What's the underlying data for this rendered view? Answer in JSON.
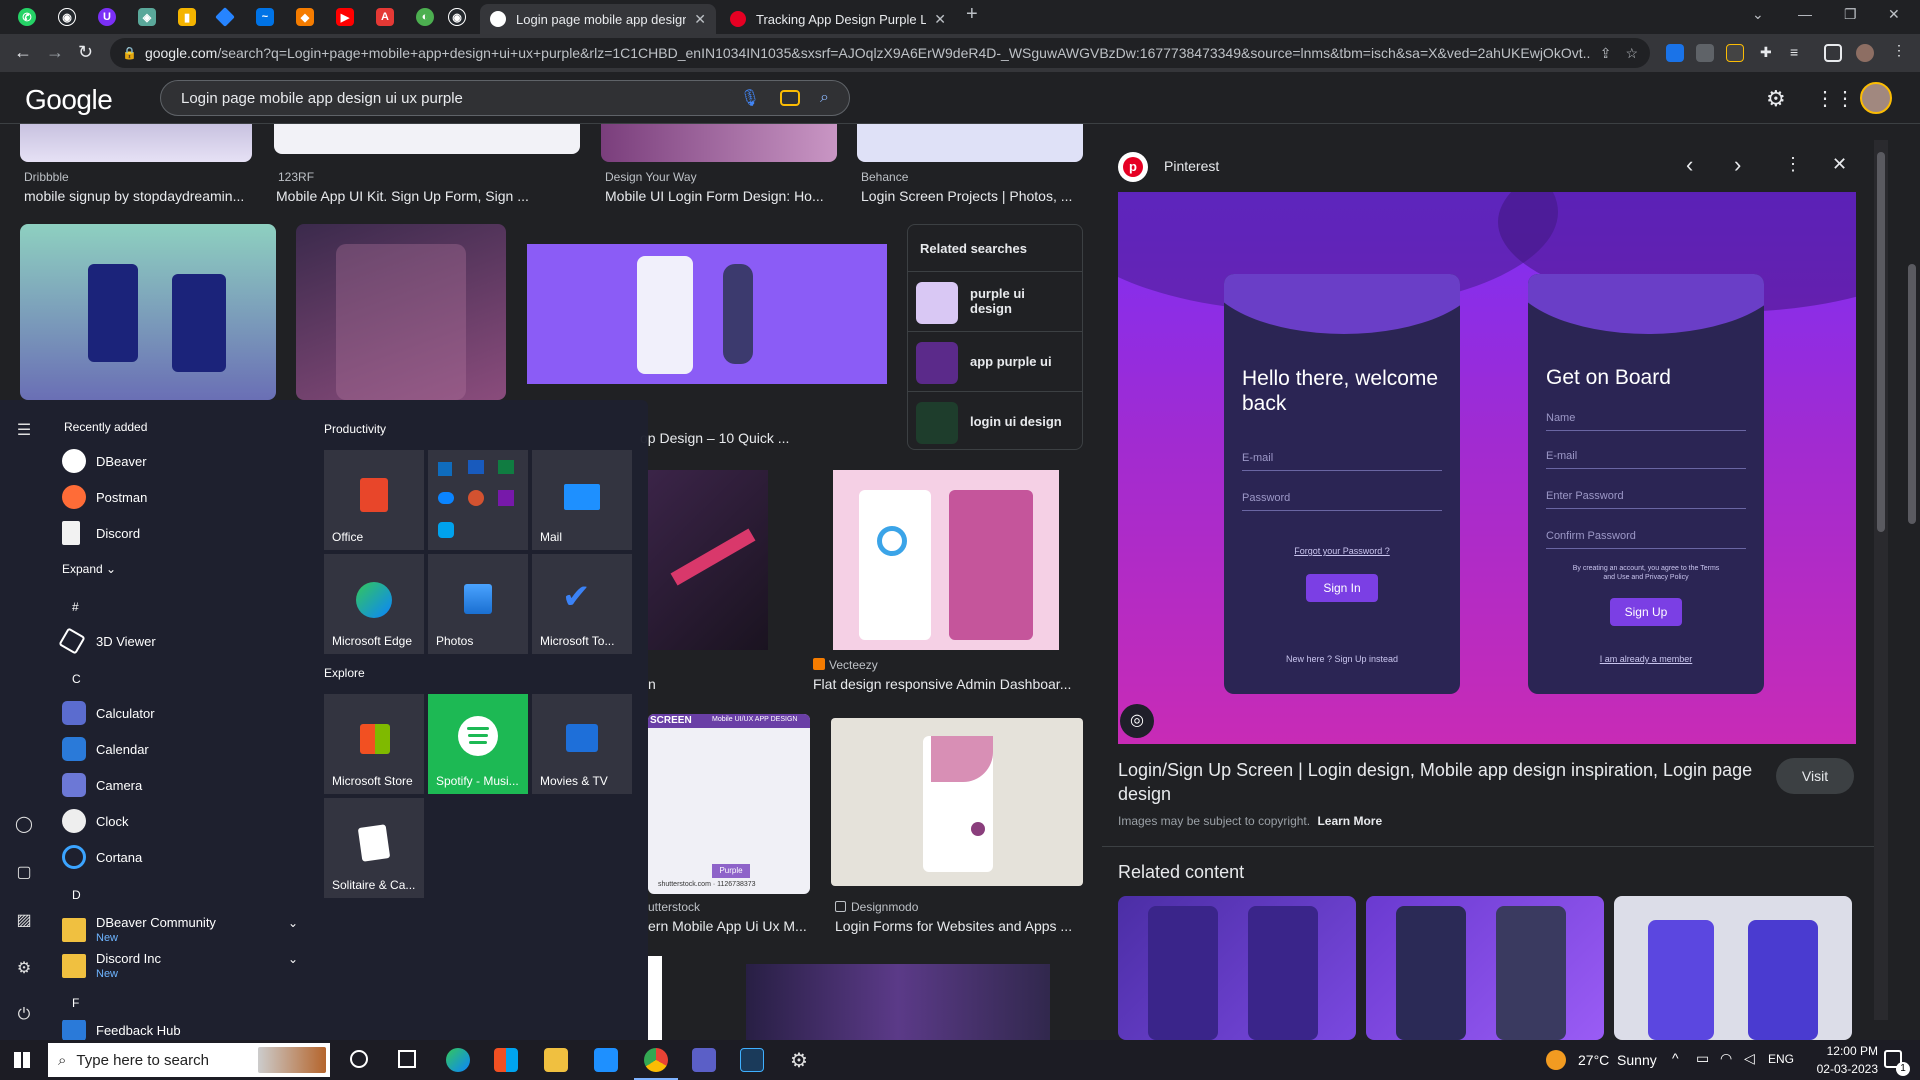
{
  "browser": {
    "tabs": [
      {
        "title": "Login page mobile app design ui",
        "active": true
      },
      {
        "title": "Tracking App Design Purple Logi",
        "active": false
      }
    ],
    "new_tab": "+",
    "url_host": "google.com",
    "url_rest": "/search?q=Login+page+mobile+app+design+ui+ux+purple&rlz=1C1CHBD_enIN1034IN1035&sxsrf=AJOqlzX9A6ErW9deR4D-_WSguwAWGVBzDw:1677738473349&source=lnms&tbm=isch&sa=X&ved=2ahUKEwjOkOvt..."
  },
  "google": {
    "logo": "Google",
    "query": "Login page mobile app design ui ux purple"
  },
  "results": {
    "row1": [
      {
        "source": "Dribbble",
        "title": "mobile signup by stopdaydreamin..."
      },
      {
        "source": "123RF",
        "title": "Mobile App UI Kit. Sign Up Form, Sign ..."
      },
      {
        "source": "Design Your Way",
        "title": "Mobile UI Login Form Design: Ho..."
      },
      {
        "source": "Behance",
        "title": "Login Screen Projects | Photos, ..."
      }
    ],
    "partial_title_1": "op Design – 10 Quick ...",
    "vecteezy": {
      "source": "Vecteezy",
      "title": "Flat design responsive Admin Dashboar..."
    },
    "shutterstock": {
      "source": "utterstock",
      "title": "ern Mobile App Ui Ux M...",
      "badge": "Purple",
      "stock_id": "shutterstock.com · 1126738373",
      "banner": "SCREEN",
      "banner2": "Mobile UI/UX APP DESIGN"
    },
    "designmodo": {
      "source": "Designmodo",
      "title": "Login Forms for Websites and Apps ..."
    },
    "partial_n": "n",
    "related": {
      "heading": "Related searches",
      "items": [
        "purple ui design",
        "app purple ui",
        "login ui design"
      ]
    }
  },
  "panel": {
    "site": "Pinterest",
    "preview": {
      "left_card": {
        "heading": "Hello there, welcome back",
        "email": "E-mail",
        "password": "Password",
        "forgot": "Forgot your Password ?",
        "button": "Sign In",
        "footer": "New here ? Sign Up instead"
      },
      "right_card": {
        "heading": "Get on Board",
        "name": "Name",
        "email": "E-mail",
        "password": "Enter Password",
        "confirm": "Confirm Password",
        "terms": "By creating an account, you agree to the Terms and Use and Privacy Policy",
        "button": "Sign Up",
        "footer": "I am already a member"
      }
    },
    "title": "Login/Sign Up Screen | Login design, Mobile app design inspiration, Login page design",
    "visit": "Visit",
    "copyright": "Images may be subject to copyright.",
    "learn_more": "Learn More",
    "related_content": "Related content"
  },
  "start_menu": {
    "recently_added": "Recently added",
    "recent": [
      "DBeaver",
      "Postman",
      "Discord"
    ],
    "expand": "Expand",
    "letters": [
      "#",
      "C",
      "D",
      "F"
    ],
    "apps_hash": [
      "3D Viewer"
    ],
    "apps_c": [
      "Calculator",
      "Calendar",
      "Camera",
      "Clock",
      "Cortana"
    ],
    "apps_d": [
      {
        "name": "DBeaver Community",
        "badge": "New"
      },
      {
        "name": "Discord Inc",
        "badge": "New"
      }
    ],
    "apps_f": [
      "Feedback Hub"
    ],
    "productivity": "Productivity",
    "explore": "Explore",
    "tiles": {
      "office": "Office",
      "mail": "Mail",
      "edge": "Microsoft Edge",
      "photos": "Photos",
      "todo": "Microsoft To...",
      "store": "Microsoft Store",
      "spotify": "Spotify - Musi...",
      "movies": "Movies & TV",
      "solitaire": "Solitaire & Ca..."
    }
  },
  "taskbar": {
    "search_placeholder": "Type here to search",
    "weather": "27°C  Sunny",
    "lang": "ENG",
    "time": "12:00 PM",
    "date": "02-03-2023",
    "notif_count": "1"
  }
}
